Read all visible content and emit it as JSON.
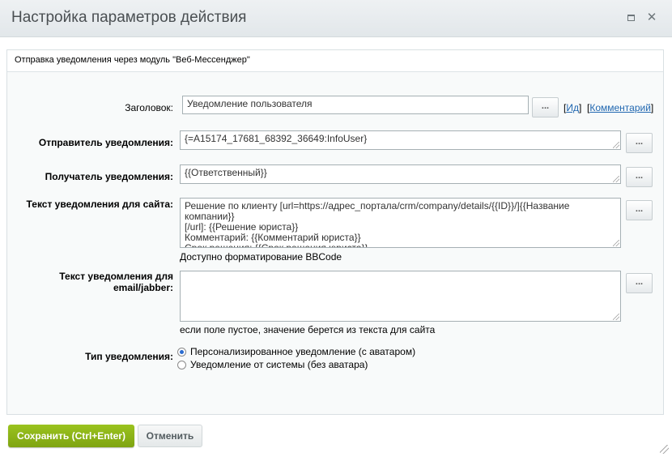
{
  "dialog": {
    "title": "Настройка параметров действия",
    "section_title": "Отправка уведомления через модуль \"Веб-Мессенджер\""
  },
  "form": {
    "header_label": "Заголовок:",
    "header_value": "Уведомление пользователя",
    "link_id": "Ид",
    "link_comment": "Комментарий",
    "sender_label": "Отправитель уведомления:",
    "sender_value": "{=A15174_17681_68392_36649:InfoUser}",
    "recipient_label": "Получатель уведомления:",
    "recipient_value": "{{Ответственный}}",
    "site_text_label": "Текст уведомления для сайта:",
    "site_text_value": "Решение по клиенту [url=https://адрес_портала/crm/company/details/{{ID}}/]{{Название компании}}\n[/url]: {{Решение юриста}}\nКомментарий: {{Комментарий юриста}}\nСрок решения: {{Срок решения юриста}}",
    "site_text_hint": "Доступно форматирование BBCode",
    "email_label": "Текст уведомления для email/jabber:",
    "email_value": "",
    "email_hint": "если поле пустое, значение берется из текста для сайта",
    "type_label": "Тип уведомления:",
    "type_options": [
      {
        "label": "Персонализированное уведомление (с аватаром)",
        "checked": true
      },
      {
        "label": "Уведомление от системы (без аватара)",
        "checked": false
      }
    ],
    "dots": "..."
  },
  "buttons": {
    "save": "Сохранить (Ctrl+Enter)",
    "cancel": "Отменить"
  }
}
